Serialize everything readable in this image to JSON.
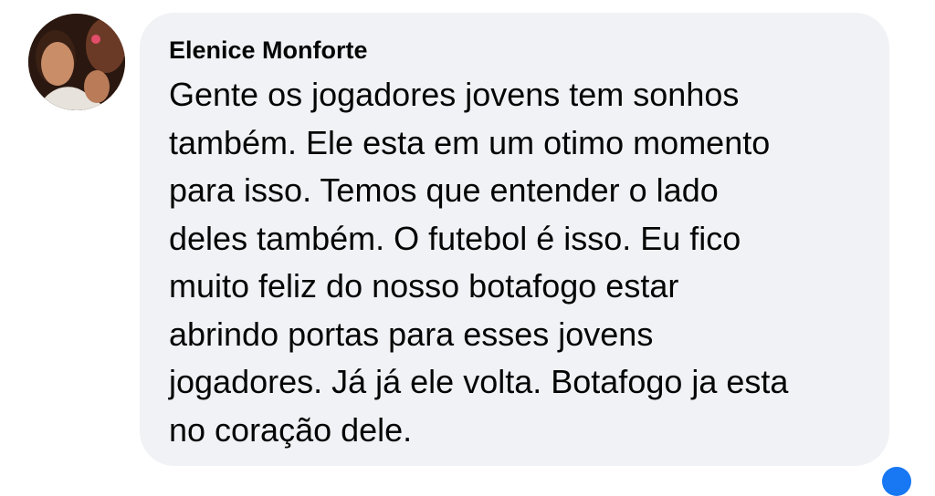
{
  "comment": {
    "author": "Elenice Monforte",
    "text": "Gente os jogadores jovens tem sonhos\ntambém. Ele esta em um otimo momento\npara isso. Temos que entender o lado\ndeles também. O futebol é isso. Eu fico\nmuito feliz do nosso botafogo estar\nabrindo portas para esses jovens\njogadores. Já já ele volta. Botafogo ja esta\nno coração dele.",
    "avatar_icon": "user-photo-avatar"
  },
  "colors": {
    "bubble_background": "#f0f2f5",
    "text": "#050505",
    "accent": "#1877f2"
  }
}
